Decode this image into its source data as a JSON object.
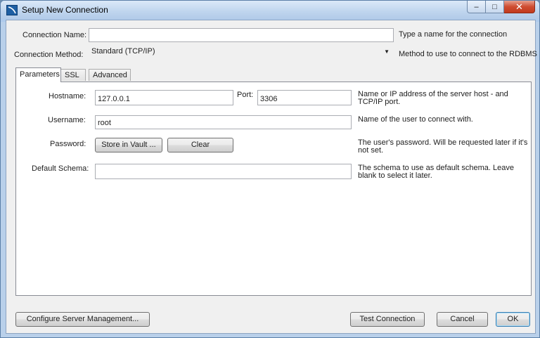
{
  "window": {
    "title": "Setup New Connection",
    "controls": {
      "minimize": "–",
      "maximize": "□",
      "close": "✕"
    }
  },
  "connection": {
    "name_label": "Connection Name:",
    "name_value": "",
    "name_hint": "Type a name for the connection",
    "method_label": "Connection Method:",
    "method_value": "Standard (TCP/IP)",
    "method_hint": "Method to use to connect to the RDBMS"
  },
  "tabs": [
    {
      "label": "Parameters",
      "active": true
    },
    {
      "label": "SSL",
      "active": false
    },
    {
      "label": "Advanced",
      "active": false
    }
  ],
  "parameters": {
    "hostname_label": "Hostname:",
    "hostname_value": "127.0.0.1",
    "port_label": "Port:",
    "port_value": "3306",
    "hostname_hint_line1": "Name or IP address of the server host - and",
    "hostname_hint_line2": "TCP/IP port.",
    "username_label": "Username:",
    "username_value": "root",
    "username_hint": "Name of the user to connect with.",
    "password_label": "Password:",
    "store_vault_label": "Store in Vault ...",
    "clear_label": "Clear",
    "password_hint_line1": "The user's password. Will be requested later if it's",
    "password_hint_line2": "not set.",
    "schema_label": "Default Schema:",
    "schema_value": "",
    "schema_hint_line1": "The schema to use as default schema. Leave",
    "schema_hint_line2": "blank to select it later."
  },
  "footer": {
    "configure_label": "Configure Server Management...",
    "test_label": "Test Connection",
    "cancel_label": "Cancel",
    "ok_label": "OK"
  },
  "colors": {
    "title_bar": "#bfd5ee",
    "dialog_background": "#f0f0f0",
    "close_button": "#c13a1e",
    "default_button_border": "#3c7fb1"
  }
}
